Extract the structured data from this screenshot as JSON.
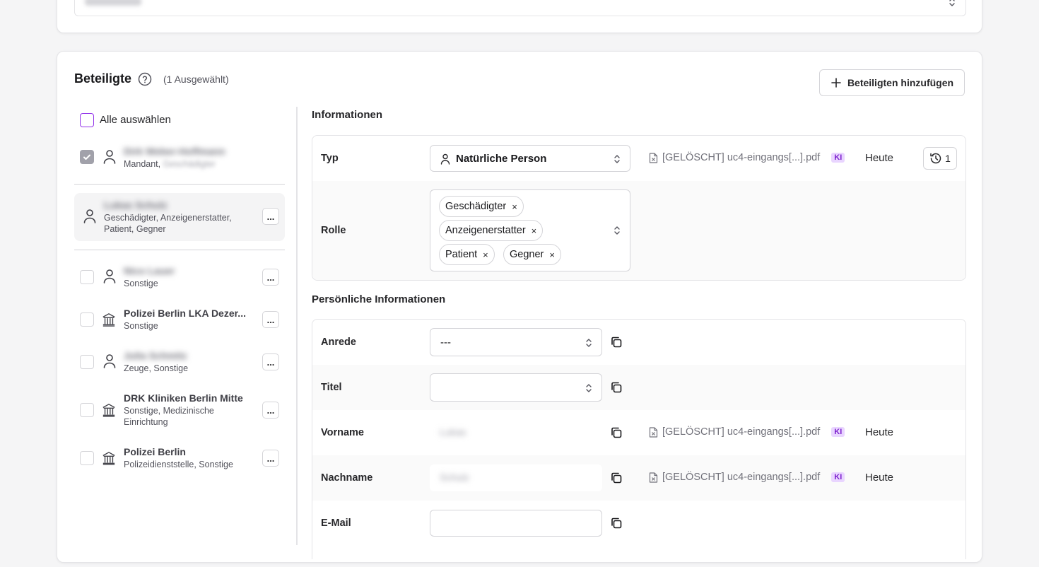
{
  "header": {
    "title": "Beteiligte",
    "selected_count": "(1 Ausgewählt)",
    "add_button": "Beteiligten hinzufügen"
  },
  "list": {
    "select_all": "Alle auswählen",
    "items": [
      {
        "name": "Dirk Weber-Hoffmann",
        "role": "Mandant,",
        "role_extra": "Geschädigter",
        "type": "person",
        "checked": true
      },
      {
        "name": "Lukas Schulz",
        "role": "Geschädigter, Anzeigenerstatter, Patient, Gegner",
        "type": "person",
        "active": true
      },
      {
        "name": "Nico Lauer",
        "role": "Sonstige",
        "type": "person"
      },
      {
        "name": "Polizei Berlin LKA Dezer...",
        "role": "Sonstige",
        "type": "institution"
      },
      {
        "name": "Julia Schmitz",
        "role": "Zeuge, Sonstige",
        "type": "person"
      },
      {
        "name": "DRK Kliniken Berlin Mitte",
        "role": "Sonstige, Medizinische Einrichtung",
        "type": "institution"
      },
      {
        "name": "Polizei Berlin",
        "role": "Polizeidienststelle, Sonstige",
        "type": "institution"
      }
    ],
    "dots_label": "..."
  },
  "info": {
    "section_title": "Informationen",
    "typ_label": "Typ",
    "typ_value": "Natürliche Person",
    "source_file": "[GELÖSCHT] uc4-eingangs[...].pdf",
    "ki_badge": "KI",
    "date": "Heute",
    "history_count": "1",
    "rolle_label": "Rolle",
    "roles": [
      "Geschädigter",
      "Anzeigenerstatter",
      "Patient",
      "Gegner"
    ],
    "chip_remove": "×"
  },
  "personal": {
    "section_title": "Persönliche Informationen",
    "anrede_label": "Anrede",
    "anrede_value": "---",
    "titel_label": "Titel",
    "titel_value": "",
    "vorname_label": "Vorname",
    "vorname_value": "Lukas",
    "nachname_label": "Nachname",
    "nachname_value": "Schulz",
    "email_label": "E-Mail",
    "email_value": ""
  },
  "colors": {
    "ki_bg": "#e9d5ff",
    "ki_fg": "#7e22ce",
    "checkbox_accent": "#9333ea"
  }
}
